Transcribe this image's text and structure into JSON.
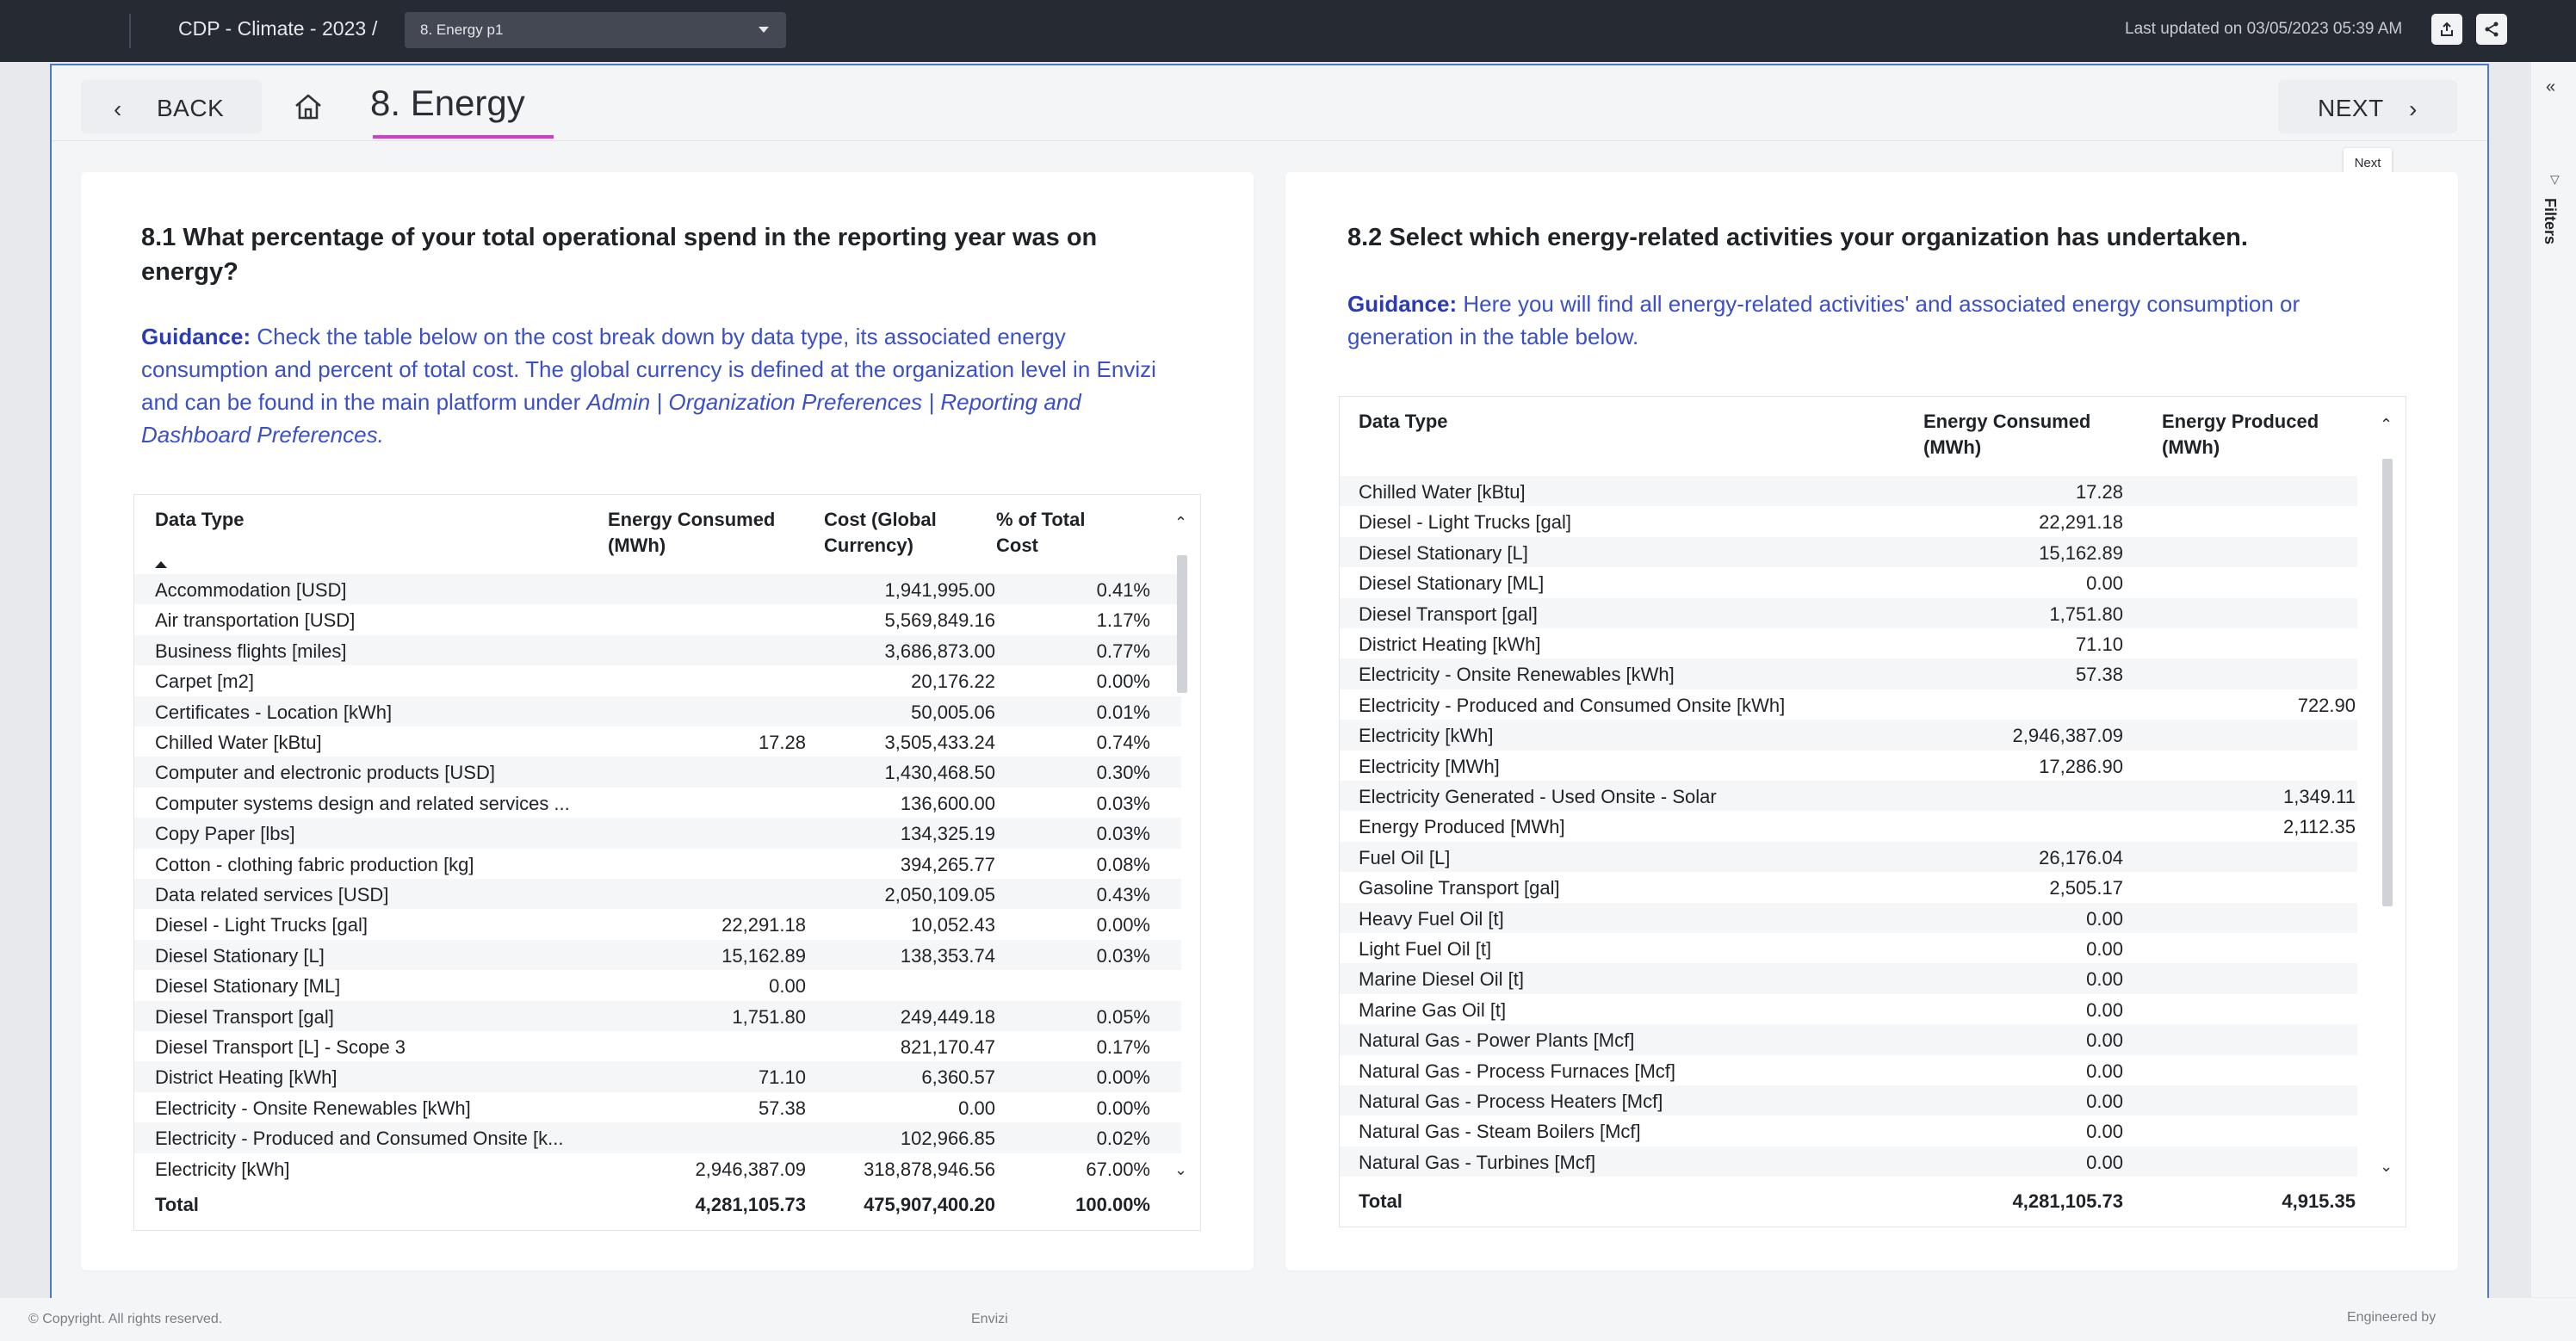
{
  "topbar": {
    "title": "CDP - Climate - 2023",
    "separator": "/",
    "page_select": "8. Energy p1",
    "last_updated": "Last updated on 03/05/2023 05:39 AM",
    "icons": [
      "export-icon",
      "share-icon"
    ]
  },
  "nav": {
    "back_label": "BACK",
    "page_heading": "8. Energy",
    "next_label": "NEXT",
    "tooltip": "Next"
  },
  "filters": {
    "label": "Filters",
    "collapse_glyph": "«"
  },
  "left": {
    "question": "8.1 What percentage of your total operational spend in the reporting year was on energy?",
    "question_lines": [
      "8.1 What percentage of your total operational spend in the reporting year was on",
      "energy?"
    ],
    "guidance_label": "Guidance:",
    "guidance_lines": [
      " Check the table below on the cost break down by data type, its associated energy",
      "consumption and percent of total cost. The global currency is defined at the organization level in Envizi",
      "and can be found in the main platform under "
    ],
    "guidance_italic_a": "Admin | Organization Preferences | Reporting and",
    "guidance_italic_b": "Dashboard Preferences.",
    "table": {
      "headers": [
        "Data Type",
        "Energy Consumed (MWh)",
        "Cost (Global Currency)",
        "% of Total Cost"
      ],
      "header_lines": [
        [
          "Data Type"
        ],
        [
          "Energy Consumed",
          "(MWh)"
        ],
        [
          "Cost (Global",
          "Currency)"
        ],
        [
          "% of Total",
          "Cost"
        ]
      ],
      "rows": [
        [
          "Accommodation [USD]",
          "",
          "1,941,995.00",
          "0.41%"
        ],
        [
          "Air transportation [USD]",
          "",
          "5,569,849.16",
          "1.17%"
        ],
        [
          "Business flights [miles]",
          "",
          "3,686,873.00",
          "0.77%"
        ],
        [
          "Carpet [m2]",
          "",
          "20,176.22",
          "0.00%"
        ],
        [
          "Certificates - Location [kWh]",
          "",
          "50,005.06",
          "0.01%"
        ],
        [
          "Chilled Water [kBtu]",
          "17.28",
          "3,505,433.24",
          "0.74%"
        ],
        [
          "Computer and electronic products [USD]",
          "",
          "1,430,468.50",
          "0.30%"
        ],
        [
          "Computer systems design and related services ...",
          "",
          "136,600.00",
          "0.03%"
        ],
        [
          "Copy Paper [lbs]",
          "",
          "134,325.19",
          "0.03%"
        ],
        [
          "Cotton - clothing fabric production [kg]",
          "",
          "394,265.77",
          "0.08%"
        ],
        [
          "Data related services [USD]",
          "",
          "2,050,109.05",
          "0.43%"
        ],
        [
          "Diesel - Light Trucks [gal]",
          "22,291.18",
          "10,052.43",
          "0.00%"
        ],
        [
          "Diesel Stationary [L]",
          "15,162.89",
          "138,353.74",
          "0.03%"
        ],
        [
          "Diesel Stationary [ML]",
          "0.00",
          "",
          ""
        ],
        [
          "Diesel Transport [gal]",
          "1,751.80",
          "249,449.18",
          "0.05%"
        ],
        [
          "Diesel Transport [L] - Scope 3",
          "",
          "821,170.47",
          "0.17%"
        ],
        [
          "District Heating [kWh]",
          "71.10",
          "6,360.57",
          "0.00%"
        ],
        [
          "Electricity - Onsite Renewables [kWh]",
          "57.38",
          "0.00",
          "0.00%"
        ],
        [
          "Electricity - Produced and Consumed Onsite [k...",
          "",
          "102,966.85",
          "0.02%"
        ],
        [
          "Electricity [kWh]",
          "2,946,387.09",
          "318,878,946.56",
          "67.00%"
        ]
      ],
      "total": [
        "Total",
        "4,281,105.73",
        "475,907,400.20",
        "100.00%"
      ]
    }
  },
  "right": {
    "question": "8.2 Select which energy-related activities your organization has undertaken.",
    "guidance_label": "Guidance:",
    "guidance_lines": [
      " Here you will find all energy-related activities' and associated energy consumption or",
      "generation in the table below."
    ],
    "table": {
      "headers": [
        "Data Type",
        "Energy Consumed (MWh)",
        "Energy Produced (MWh)"
      ],
      "header_lines": [
        [
          "Data Type"
        ],
        [
          "Energy Consumed",
          "(MWh)"
        ],
        [
          "Energy Produced",
          "(MWh)"
        ]
      ],
      "rows": [
        [
          "Chilled Water [kBtu]",
          "17.28",
          ""
        ],
        [
          "Diesel - Light Trucks [gal]",
          "22,291.18",
          ""
        ],
        [
          "Diesel Stationary [L]",
          "15,162.89",
          ""
        ],
        [
          "Diesel Stationary [ML]",
          "0.00",
          ""
        ],
        [
          "Diesel Transport [gal]",
          "1,751.80",
          ""
        ],
        [
          "District Heating [kWh]",
          "71.10",
          ""
        ],
        [
          "Electricity - Onsite Renewables [kWh]",
          "57.38",
          ""
        ],
        [
          "Electricity - Produced and Consumed Onsite [kWh]",
          "",
          "722.90"
        ],
        [
          "Electricity [kWh]",
          "2,946,387.09",
          ""
        ],
        [
          "Electricity [MWh]",
          "17,286.90",
          ""
        ],
        [
          "Electricity Generated - Used Onsite - Solar",
          "",
          "1,349.11"
        ],
        [
          "Energy Produced [MWh]",
          "",
          "2,112.35"
        ],
        [
          "Fuel Oil [L]",
          "26,176.04",
          ""
        ],
        [
          "Gasoline Transport [gal]",
          "2,505.17",
          ""
        ],
        [
          "Heavy Fuel Oil [t]",
          "0.00",
          ""
        ],
        [
          "Light Fuel Oil [t]",
          "0.00",
          ""
        ],
        [
          "Marine Diesel Oil [t]",
          "0.00",
          ""
        ],
        [
          "Marine Gas Oil [t]",
          "0.00",
          ""
        ],
        [
          "Natural Gas - Power Plants [Mcf]",
          "0.00",
          ""
        ],
        [
          "Natural Gas - Process Furnaces [Mcf]",
          "0.00",
          ""
        ],
        [
          "Natural Gas - Process Heaters [Mcf]",
          "0.00",
          ""
        ],
        [
          "Natural Gas - Steam Boilers [Mcf]",
          "0.00",
          ""
        ],
        [
          "Natural Gas - Turbines [Mcf]",
          "0.00",
          ""
        ]
      ],
      "total": [
        "Total",
        "4,281,105.73",
        "4,915.35"
      ]
    }
  },
  "footer": {
    "copyright": "© Copyright. All rights reserved.",
    "center": "Envizi",
    "right": "Engineered by"
  }
}
